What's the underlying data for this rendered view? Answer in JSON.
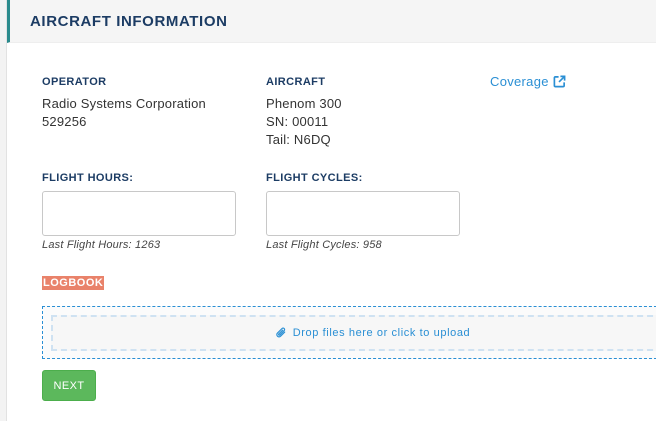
{
  "panel": {
    "title": "AIRCRAFT INFORMATION"
  },
  "operator": {
    "label": "OPERATOR",
    "name": "Radio Systems Corporation",
    "number": "529256"
  },
  "aircraft": {
    "label": "AIRCRAFT",
    "model": "Phenom 300",
    "serial": "SN: 00011",
    "tail": "Tail: N6DQ"
  },
  "coverage": {
    "label": "Coverage",
    "icon": "external-link-icon"
  },
  "flight_hours": {
    "label": "FLIGHT HOURS:",
    "value": "",
    "placeholder": "",
    "hint": "Last Flight Hours: 1263"
  },
  "flight_cycles": {
    "label": "FLIGHT CYCLES:",
    "value": "",
    "placeholder": "",
    "hint": "Last Flight Cycles: 958"
  },
  "logbook": {
    "label": "LOGBOOK"
  },
  "dropzone": {
    "text": "Drop files here or click to upload",
    "icon": "paperclip-icon"
  },
  "actions": {
    "next_label": "NEXT"
  },
  "colors": {
    "accent": "#2a8a8c",
    "heading": "#1c3c64",
    "link": "#2a8fd4",
    "logbook_bg": "#e9826a",
    "next_button": "#5cb85c"
  }
}
